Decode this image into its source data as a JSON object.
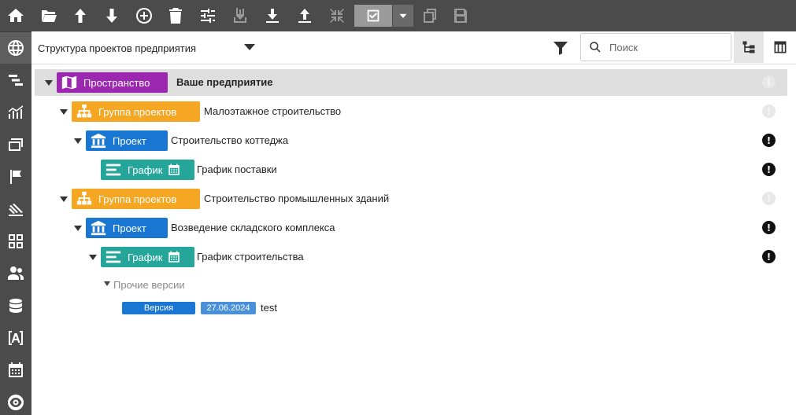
{
  "colors": {
    "chrome": "#4b4b4b",
    "space": "#9c27b0",
    "group": "#f5a623",
    "project": "#1976d2",
    "schedule": "#26a69a",
    "row_highlight": "#dedede"
  },
  "rail": {
    "items": [
      {
        "icon": "home-icon"
      },
      {
        "icon": "globe-icon",
        "active": true
      },
      {
        "icon": "task-bars-icon"
      },
      {
        "icon": "chart-trend-icon"
      },
      {
        "icon": "cards-icon"
      },
      {
        "icon": "flag-icon"
      },
      {
        "icon": "stripes-icon"
      },
      {
        "icon": "grid-icon"
      },
      {
        "icon": "people-icon"
      },
      {
        "icon": "database-icon"
      },
      {
        "icon": "text-box-icon"
      },
      {
        "icon": "calendar-icon"
      },
      {
        "icon": "eye-icon"
      }
    ]
  },
  "toolbar": {
    "items": [
      {
        "icon": "open-folder-icon"
      },
      {
        "icon": "arrow-up-icon"
      },
      {
        "icon": "arrow-down-icon"
      },
      {
        "icon": "add-circle-icon"
      },
      {
        "icon": "trash-icon"
      },
      {
        "icon": "sliders-icon"
      },
      {
        "icon": "move-down-icon",
        "disabled": true
      },
      {
        "icon": "download-icon"
      },
      {
        "icon": "upload-icon"
      },
      {
        "icon": "collapse-icon",
        "disabled": true
      },
      {
        "icon": "check-icon"
      },
      {
        "icon": "dropdown-caret-icon"
      },
      {
        "icon": "copy-icon",
        "disabled": true
      },
      {
        "icon": "save-icon",
        "disabled": true
      }
    ]
  },
  "header": {
    "structure_label": "Структура проектов предприятия",
    "search_placeholder": "Поиск"
  },
  "tree": {
    "space": {
      "label": "Пространство",
      "title": "Ваше предприятие"
    },
    "group1": {
      "label": "Группа проектов",
      "title": "Малоэтажное строительство"
    },
    "project1": {
      "label": "Проект",
      "title": "Строительство коттеджа"
    },
    "schedule1": {
      "label": "График",
      "title": "График поставки"
    },
    "group2": {
      "label": "Группа проектов",
      "title": "Строительство промышленных зданий"
    },
    "project2": {
      "label": "Проект",
      "title": "Возведение складского комплекса"
    },
    "schedule2": {
      "label": "График",
      "title": "График строительства"
    },
    "other_versions": "Прочие версии",
    "version": {
      "label": "Версия",
      "date": "27.06.2024",
      "name": "test"
    },
    "alert_glyph": "!"
  }
}
